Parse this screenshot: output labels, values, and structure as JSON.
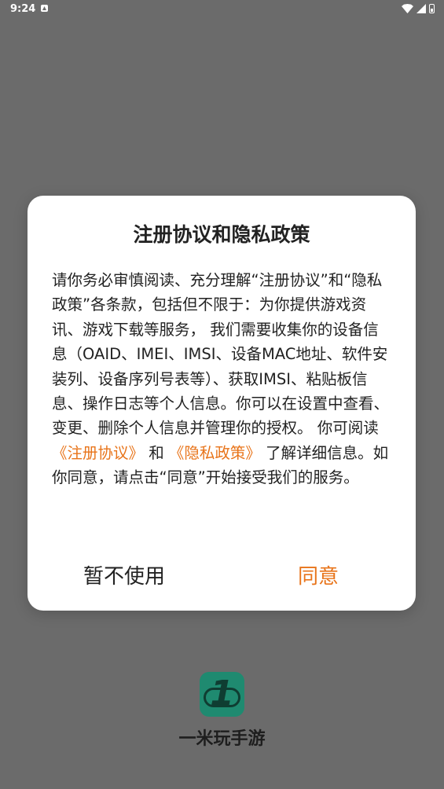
{
  "status_bar": {
    "time": "9:24",
    "icons": [
      "notification-icon",
      "wifi-icon",
      "signal-icon",
      "battery-icon"
    ]
  },
  "dialog": {
    "title": "注册协议和隐私政策",
    "body_1": "请你务必审慎阅读、充分理解“注册协议”和“隐私政策”各条款，包括但不限于：为你提供游戏资讯、游戏下载等服务， 我们需要收集你的设备信息（OAID、IMEI、IMSI、设备MAC地址、软件安装列、设备序列号表等）、获取IMSI、粘贴板信息、操作日志等个人信息。你可以在设置中查看、变更、删除个人信息并管理你的授权。 你可阅读 ",
    "link_agreement": "《注册协议》",
    "body_and": " 和 ",
    "link_privacy": "《隐私政策》",
    "body_2": " 了解详细信息。如你同意，请点击“同意”开始接受我们的服务。",
    "decline_label": "暂不使用",
    "agree_label": "同意"
  },
  "app": {
    "logo_text": "1",
    "name": "一米玩手游"
  },
  "colors": {
    "overlay": "#6b6b6b",
    "accent": "#e8741a",
    "logo": "#1f8a70"
  }
}
